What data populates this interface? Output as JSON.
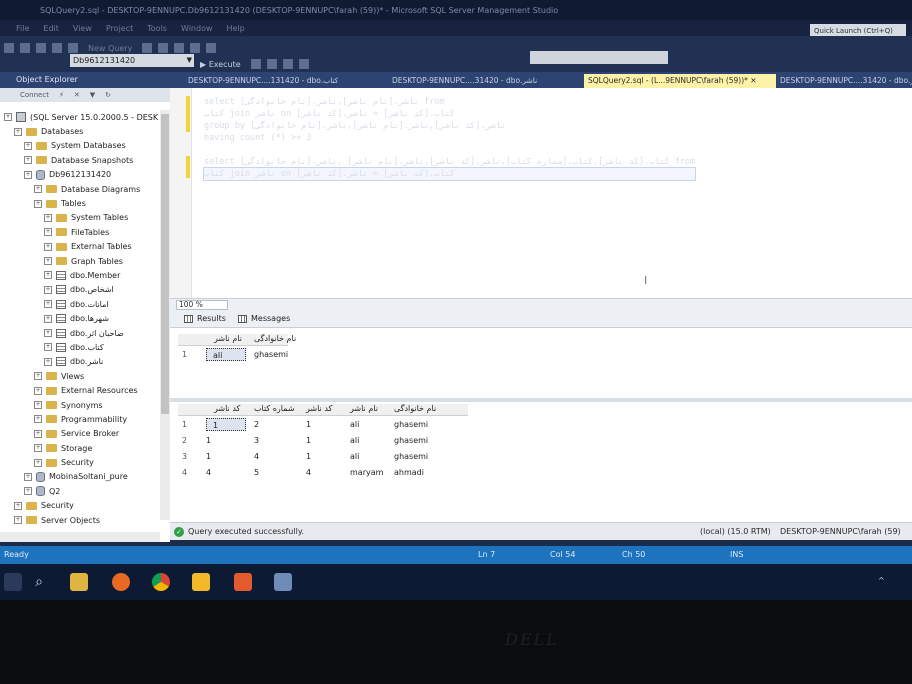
{
  "window": {
    "title": "SQLQuery2.sql - DESKTOP-9ENNUPC.Db9612131420 (DESKTOP-9ENNUPC\\farah (59))* - Microsoft SQL Server Management Studio",
    "quick_launch": "Quick Launch (Ctrl+Q)"
  },
  "menu": [
    "File",
    "Edit",
    "View",
    "Project",
    "Tools",
    "Window",
    "Help"
  ],
  "toolbar": {
    "new_query": "New Query",
    "execute": "Execute",
    "database": "Db9612131420"
  },
  "object_explorer": {
    "title": "Object Explorer",
    "connect": "Connect",
    "nodes": [
      {
        "label": "(SQL Server 15.0.2000.5 - DESK",
        "indent": 0,
        "icon": "server"
      },
      {
        "label": "Databases",
        "indent": 1,
        "icon": "folder"
      },
      {
        "label": "System Databases",
        "indent": 2,
        "icon": "folder"
      },
      {
        "label": "Database Snapshots",
        "indent": 2,
        "icon": "folder"
      },
      {
        "label": "Db9612131420",
        "indent": 2,
        "icon": "database"
      },
      {
        "label": "Database Diagrams",
        "indent": 3,
        "icon": "folder"
      },
      {
        "label": "Tables",
        "indent": 3,
        "icon": "folder"
      },
      {
        "label": "System Tables",
        "indent": 4,
        "icon": "folder"
      },
      {
        "label": "FileTables",
        "indent": 4,
        "icon": "folder"
      },
      {
        "label": "External Tables",
        "indent": 4,
        "icon": "folder"
      },
      {
        "label": "Graph Tables",
        "indent": 4,
        "icon": "folder"
      },
      {
        "label": "dbo.Member",
        "indent": 4,
        "icon": "table"
      },
      {
        "label": "dbo.اشخاص",
        "indent": 4,
        "icon": "table"
      },
      {
        "label": "dbo.امانات",
        "indent": 4,
        "icon": "table"
      },
      {
        "label": "dbo.شهرها",
        "indent": 4,
        "icon": "table"
      },
      {
        "label": "dbo.صاحبان اثر",
        "indent": 4,
        "icon": "table"
      },
      {
        "label": "dbo.كتاب",
        "indent": 4,
        "icon": "table"
      },
      {
        "label": "dbo.ناشر",
        "indent": 4,
        "icon": "table"
      },
      {
        "label": "Views",
        "indent": 3,
        "icon": "folder"
      },
      {
        "label": "External Resources",
        "indent": 3,
        "icon": "folder"
      },
      {
        "label": "Synonyms",
        "indent": 3,
        "icon": "folder"
      },
      {
        "label": "Programmability",
        "indent": 3,
        "icon": "folder"
      },
      {
        "label": "Service Broker",
        "indent": 3,
        "icon": "folder"
      },
      {
        "label": "Storage",
        "indent": 3,
        "icon": "folder"
      },
      {
        "label": "Security",
        "indent": 3,
        "icon": "folder"
      },
      {
        "label": "MobinaSoltani_pure",
        "indent": 2,
        "icon": "database"
      },
      {
        "label": "Q2",
        "indent": 2,
        "icon": "database"
      },
      {
        "label": "Security",
        "indent": 1,
        "icon": "folder"
      },
      {
        "label": "Server Objects",
        "indent": 1,
        "icon": "folder"
      }
    ]
  },
  "tabs": [
    {
      "label": "DESKTOP-9ENNUPC....131420 - dbo.كتاب",
      "active": false
    },
    {
      "label": "DESKTOP-9ENNUPC....31420 - dbo.ناشر",
      "active": false
    },
    {
      "label": "SQLQuery2.sql - (L...9ENNUPC\\farah (59))*",
      "active": true
    },
    {
      "label": "DESKTOP-9ENNUPC....31420 - dbo.ناشر",
      "active": false
    }
  ],
  "editor": {
    "lines": [
      "select ناشر.[نام ناشر],ناشر.[نام خانوادگی] from",
      "كتاب join ناشر on كتاب.[كد ناشر] = ناشر.[كد ناشر]",
      "group by ناشر.[كد ناشر],ناشر.[نام ناشر],ناشر.[نام خانوادگی]",
      "having count (*) >= 3",
      "",
      "select كتاب.[كد ناشر],كتاب.[شماره كتاب],ناشر.[كد ناشر],ناشر.[نام ناشر] ,ناشر.[نام خانوادگی] from",
      "كتاب join ناشر on كتاب.[كد ناشر] = ناشر.[كد ناشر]"
    ]
  },
  "zoom": "100 %",
  "results_tabs": {
    "results": "Results",
    "messages": "Messages"
  },
  "grid1": {
    "columns": [
      "نام ناشر",
      "نام خانوادگی"
    ],
    "rows": [
      [
        "ali",
        "ghasemi"
      ]
    ]
  },
  "grid2": {
    "columns": [
      "كد ناشر",
      "شماره كتاب",
      "كد ناشر",
      "نام ناشر",
      "نام خانوادگی"
    ],
    "rows": [
      [
        "1",
        "2",
        "1",
        "ali",
        "ghasemi"
      ],
      [
        "1",
        "3",
        "1",
        "ali",
        "ghasemi"
      ],
      [
        "1",
        "4",
        "1",
        "ali",
        "ghasemi"
      ],
      [
        "4",
        "5",
        "4",
        "maryam",
        "ahmadi"
      ]
    ]
  },
  "query_status": {
    "message": "Query executed successfully.",
    "server": "(local) (15.0 RTM)",
    "connection": "DESKTOP-9ENNUPC\\farah (59)"
  },
  "statusbar": {
    "ready": "Ready",
    "line": "Ln 7",
    "col": "Col 54",
    "ch": "Ch 50",
    "mode": "INS"
  },
  "brand": "DELL"
}
